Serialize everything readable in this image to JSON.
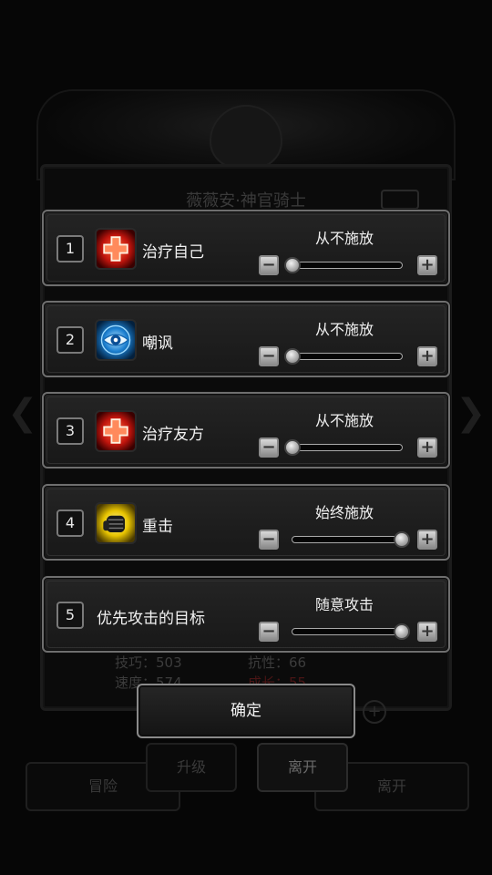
{
  "background": {
    "title": "薇薇安·神官骑士",
    "stats": {
      "skill": "技巧：503",
      "speed": "速度：574",
      "resist": "抗性：66",
      "growth": "成长：55"
    },
    "buttons": {
      "adventure": "冒险",
      "upgrade": "升级",
      "leave_fore": "离开",
      "leave_back": "离开"
    }
  },
  "skills": [
    {
      "number": "1",
      "name": "治疗自己",
      "icon": "heal-cross-icon",
      "mode": "从不施放",
      "level": 0.0
    },
    {
      "number": "2",
      "name": "嘲讽",
      "icon": "eye-taunt-icon",
      "mode": "从不施放",
      "level": 0.0
    },
    {
      "number": "3",
      "name": "治疗友方",
      "icon": "heal-cross-icon",
      "mode": "从不施放",
      "level": 0.0
    },
    {
      "number": "4",
      "name": "重击",
      "icon": "fist-strike-icon",
      "mode": "始终施放",
      "level": 1.0
    },
    {
      "number": "5",
      "name": "优先攻击的目标",
      "icon": "",
      "mode": "随意攻击",
      "level": 1.0
    }
  ],
  "confirm_label": "确定",
  "colors": {
    "heal_icon": "#c0150d",
    "taunt_icon": "#1b7fd0",
    "strike_icon": "#e8c400",
    "panel_border": "#6f6f6f"
  }
}
